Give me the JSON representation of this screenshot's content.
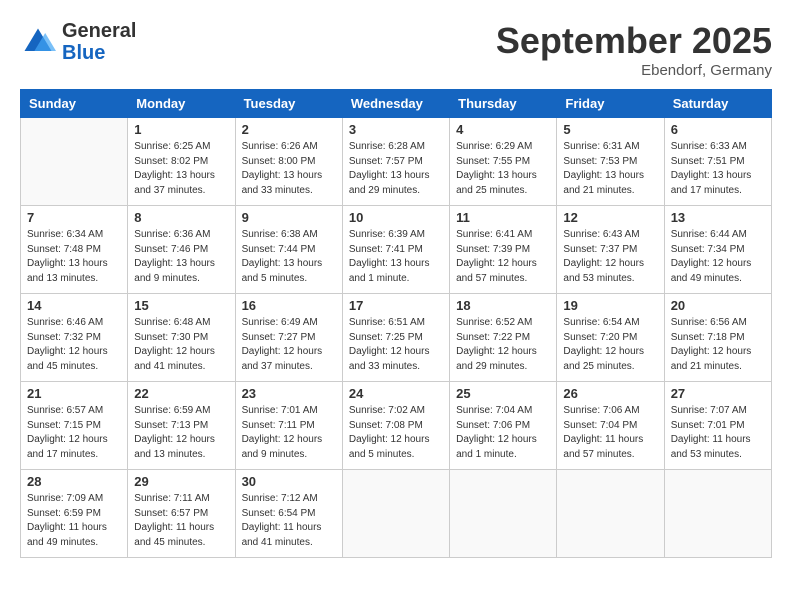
{
  "logo": {
    "general": "General",
    "blue": "Blue"
  },
  "header": {
    "month": "September 2025",
    "location": "Ebendorf, Germany"
  },
  "weekdays": [
    "Sunday",
    "Monday",
    "Tuesday",
    "Wednesday",
    "Thursday",
    "Friday",
    "Saturday"
  ],
  "weeks": [
    [
      {
        "day": "",
        "info": ""
      },
      {
        "day": "1",
        "info": "Sunrise: 6:25 AM\nSunset: 8:02 PM\nDaylight: 13 hours\nand 37 minutes."
      },
      {
        "day": "2",
        "info": "Sunrise: 6:26 AM\nSunset: 8:00 PM\nDaylight: 13 hours\nand 33 minutes."
      },
      {
        "day": "3",
        "info": "Sunrise: 6:28 AM\nSunset: 7:57 PM\nDaylight: 13 hours\nand 29 minutes."
      },
      {
        "day": "4",
        "info": "Sunrise: 6:29 AM\nSunset: 7:55 PM\nDaylight: 13 hours\nand 25 minutes."
      },
      {
        "day": "5",
        "info": "Sunrise: 6:31 AM\nSunset: 7:53 PM\nDaylight: 13 hours\nand 21 minutes."
      },
      {
        "day": "6",
        "info": "Sunrise: 6:33 AM\nSunset: 7:51 PM\nDaylight: 13 hours\nand 17 minutes."
      }
    ],
    [
      {
        "day": "7",
        "info": "Sunrise: 6:34 AM\nSunset: 7:48 PM\nDaylight: 13 hours\nand 13 minutes."
      },
      {
        "day": "8",
        "info": "Sunrise: 6:36 AM\nSunset: 7:46 PM\nDaylight: 13 hours\nand 9 minutes."
      },
      {
        "day": "9",
        "info": "Sunrise: 6:38 AM\nSunset: 7:44 PM\nDaylight: 13 hours\nand 5 minutes."
      },
      {
        "day": "10",
        "info": "Sunrise: 6:39 AM\nSunset: 7:41 PM\nDaylight: 13 hours\nand 1 minute."
      },
      {
        "day": "11",
        "info": "Sunrise: 6:41 AM\nSunset: 7:39 PM\nDaylight: 12 hours\nand 57 minutes."
      },
      {
        "day": "12",
        "info": "Sunrise: 6:43 AM\nSunset: 7:37 PM\nDaylight: 12 hours\nand 53 minutes."
      },
      {
        "day": "13",
        "info": "Sunrise: 6:44 AM\nSunset: 7:34 PM\nDaylight: 12 hours\nand 49 minutes."
      }
    ],
    [
      {
        "day": "14",
        "info": "Sunrise: 6:46 AM\nSunset: 7:32 PM\nDaylight: 12 hours\nand 45 minutes."
      },
      {
        "day": "15",
        "info": "Sunrise: 6:48 AM\nSunset: 7:30 PM\nDaylight: 12 hours\nand 41 minutes."
      },
      {
        "day": "16",
        "info": "Sunrise: 6:49 AM\nSunset: 7:27 PM\nDaylight: 12 hours\nand 37 minutes."
      },
      {
        "day": "17",
        "info": "Sunrise: 6:51 AM\nSunset: 7:25 PM\nDaylight: 12 hours\nand 33 minutes."
      },
      {
        "day": "18",
        "info": "Sunrise: 6:52 AM\nSunset: 7:22 PM\nDaylight: 12 hours\nand 29 minutes."
      },
      {
        "day": "19",
        "info": "Sunrise: 6:54 AM\nSunset: 7:20 PM\nDaylight: 12 hours\nand 25 minutes."
      },
      {
        "day": "20",
        "info": "Sunrise: 6:56 AM\nSunset: 7:18 PM\nDaylight: 12 hours\nand 21 minutes."
      }
    ],
    [
      {
        "day": "21",
        "info": "Sunrise: 6:57 AM\nSunset: 7:15 PM\nDaylight: 12 hours\nand 17 minutes."
      },
      {
        "day": "22",
        "info": "Sunrise: 6:59 AM\nSunset: 7:13 PM\nDaylight: 12 hours\nand 13 minutes."
      },
      {
        "day": "23",
        "info": "Sunrise: 7:01 AM\nSunset: 7:11 PM\nDaylight: 12 hours\nand 9 minutes."
      },
      {
        "day": "24",
        "info": "Sunrise: 7:02 AM\nSunset: 7:08 PM\nDaylight: 12 hours\nand 5 minutes."
      },
      {
        "day": "25",
        "info": "Sunrise: 7:04 AM\nSunset: 7:06 PM\nDaylight: 12 hours\nand 1 minute."
      },
      {
        "day": "26",
        "info": "Sunrise: 7:06 AM\nSunset: 7:04 PM\nDaylight: 11 hours\nand 57 minutes."
      },
      {
        "day": "27",
        "info": "Sunrise: 7:07 AM\nSunset: 7:01 PM\nDaylight: 11 hours\nand 53 minutes."
      }
    ],
    [
      {
        "day": "28",
        "info": "Sunrise: 7:09 AM\nSunset: 6:59 PM\nDaylight: 11 hours\nand 49 minutes."
      },
      {
        "day": "29",
        "info": "Sunrise: 7:11 AM\nSunset: 6:57 PM\nDaylight: 11 hours\nand 45 minutes."
      },
      {
        "day": "30",
        "info": "Sunrise: 7:12 AM\nSunset: 6:54 PM\nDaylight: 11 hours\nand 41 minutes."
      },
      {
        "day": "",
        "info": ""
      },
      {
        "day": "",
        "info": ""
      },
      {
        "day": "",
        "info": ""
      },
      {
        "day": "",
        "info": ""
      }
    ]
  ]
}
